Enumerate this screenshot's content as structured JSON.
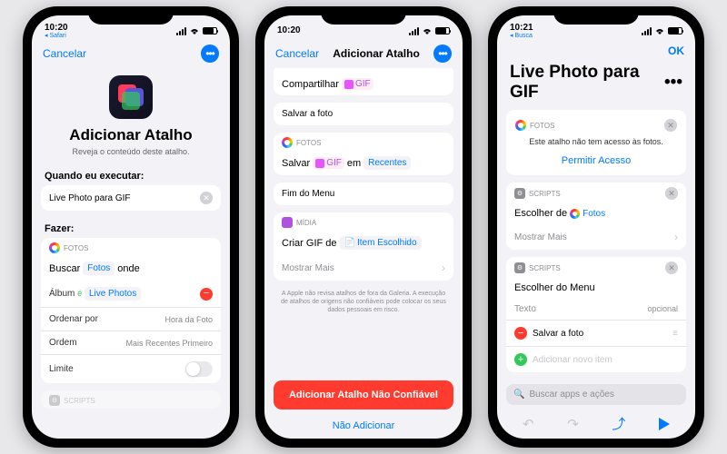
{
  "status": {
    "time1": "10:20",
    "time2": "10:20",
    "time3": "10:21",
    "back1": "Safari",
    "back3": "Busca"
  },
  "p1": {
    "nav_cancel": "Cancelar",
    "title": "Adicionar Atalho",
    "subtitle": "Reveja o conteúdo deste atalho.",
    "when_label": "Quando eu executar:",
    "shortcut_name": "Live Photo para GIF",
    "do_label": "Fazer:",
    "fotos_header": "FOTOS",
    "search_parts": {
      "a": "Buscar",
      "b": "Fotos",
      "c": "onde"
    },
    "album_row": {
      "k": "Álbum",
      "op": "é",
      "v": "Live Photos"
    },
    "sort_row": {
      "k": "Ordenar por",
      "v": "Hora da Foto"
    },
    "order_row": {
      "k": "Ordem",
      "v": "Mais Recentes Primeiro"
    },
    "limit_row": {
      "k": "Limite"
    },
    "scripts_hint": "SCRIPTS"
  },
  "p2": {
    "nav_cancel": "Cancelar",
    "nav_title": "Adicionar Atalho",
    "share_row": {
      "a": "Compartilhar",
      "gif": "GIF"
    },
    "save_photo": "Salvar a foto",
    "fotos_header": "FOTOS",
    "save_parts": {
      "a": "Salvar",
      "gif": "GIF",
      "b": "em",
      "c": "Recentes"
    },
    "end_menu": "Fim do Menu",
    "media_header": "MÍDIA",
    "create_gif": {
      "a": "Criar GIF de",
      "b": "Item Escolhido"
    },
    "show_more": "Mostrar Mais",
    "footer": "A Apple não revisa atalhos de fora da Galeria. A execução de atalhos de origens não confiáveis pode colocar os seus dados pessoais em risco.",
    "add_btn": "Adicionar Atalho Não Confiável",
    "dont_add": "Não Adicionar"
  },
  "p3": {
    "ok": "OK",
    "title": "Live Photo para GIF",
    "fotos_header": "FOTOS",
    "no_access": "Este atalho não tem acesso às fotos.",
    "allow": "Permitir Acesso",
    "scripts_header": "SCRIPTS",
    "choose_from": {
      "a": "Escolher de",
      "b": "Fotos"
    },
    "show_more": "Mostrar Mais",
    "choose_menu": "Escolher do Menu",
    "text_label": "Texto",
    "optional": "opcional",
    "item1": "Salvar a foto",
    "item2": "Adicionar novo item",
    "search_placeholder": "Buscar apps e ações"
  }
}
